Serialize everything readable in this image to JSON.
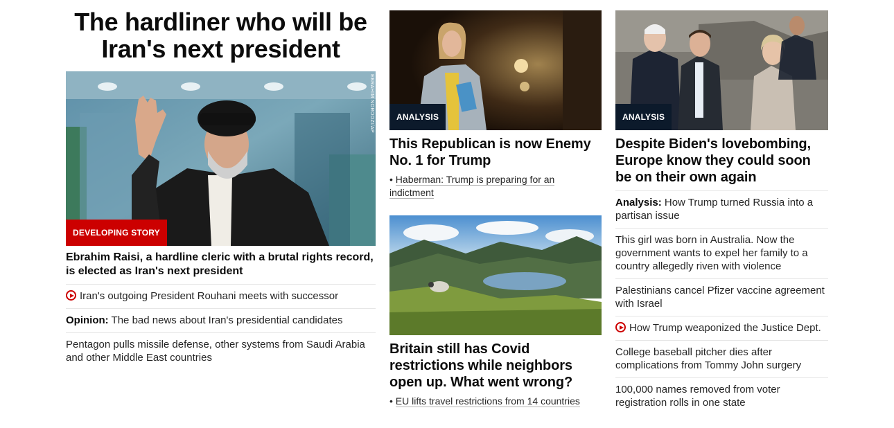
{
  "col1": {
    "headline": "The hardliner who will be Iran's next president",
    "image": {
      "alt": "Ebrahim Raisi waving",
      "credit": "EBRAHIM NOROOZI/AP"
    },
    "badge": "DEVELOPING STORY",
    "lead": "Ebrahim Raisi, a hardline cleric with a brutal rights record, is elected as Iran's next president",
    "items": [
      {
        "prefix": "",
        "text": "Iran's outgoing President Rouhani meets with successor",
        "icon": "play-icon"
      },
      {
        "prefix": "Opinion:",
        "text": " The bad news about Iran's presidential candidates",
        "icon": ""
      },
      {
        "prefix": "",
        "text": "Pentagon pulls missile defense, other systems from Saudi Arabia and other Middle East countries",
        "icon": ""
      }
    ]
  },
  "col2": {
    "story1": {
      "badge": "ANALYSIS",
      "headline": "This Republican is now Enemy No. 1 for Trump",
      "sub": "Haberman: Trump is preparing for an indictment"
    },
    "story2": {
      "headline": "Britain still has Covid restrictions while neighbors open up. What went wrong?",
      "sub": "EU lifts travel restrictions from 14 countries"
    },
    "bullet": "•"
  },
  "col3": {
    "badge": "ANALYSIS",
    "headline": "Despite Biden's lovebombing, Europe know they could soon be on their own again",
    "items": [
      {
        "prefix": "Analysis:",
        "text": " How Trump turned Russia into a partisan issue",
        "icon": ""
      },
      {
        "prefix": "",
        "text": "This girl was born in Australia. Now the government wants to expel her family to a country allegedly riven with violence",
        "icon": ""
      },
      {
        "prefix": "",
        "text": "Palestinians cancel Pfizer vaccine agreement with Israel",
        "icon": ""
      },
      {
        "prefix": "",
        "text": "How Trump weaponized the Justice Dept.",
        "icon": "play-icon"
      },
      {
        "prefix": "",
        "text": "College baseball pitcher dies after complications from Tommy John surgery",
        "icon": ""
      },
      {
        "prefix": "",
        "text": "100,000 names removed from voter registration rolls in one state",
        "icon": ""
      }
    ]
  },
  "colors": {
    "accent": "#cc0000",
    "badge_dark": "#0c1a2b",
    "text": "#0c0c0c"
  }
}
